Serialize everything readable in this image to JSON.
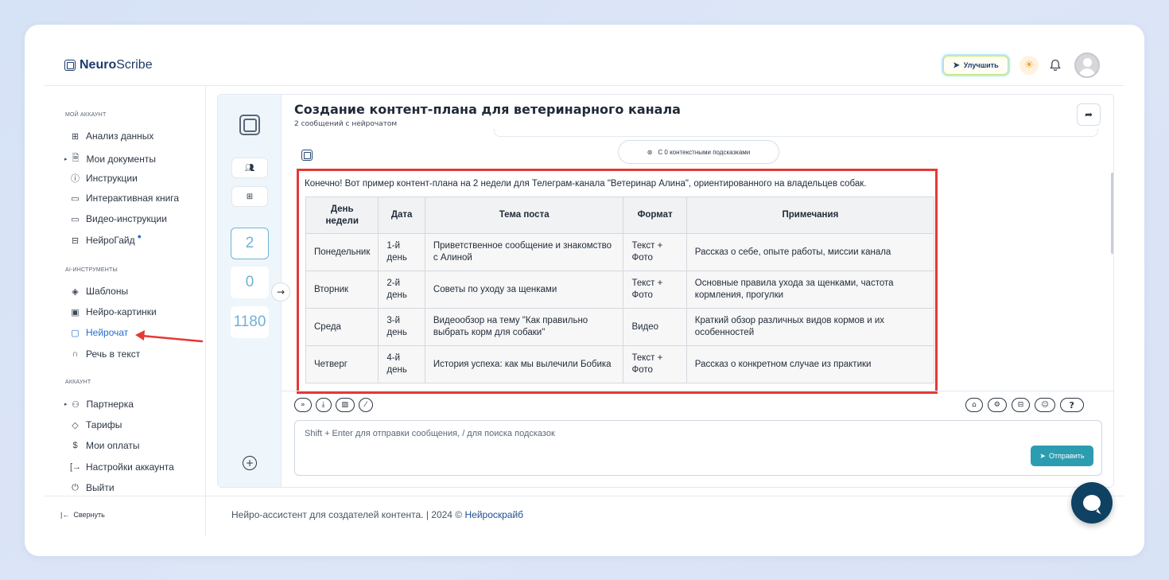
{
  "app": {
    "logo_bold": "Neuro",
    "logo_light": "Scribe",
    "upgrade_label": "Улучшить"
  },
  "sidebar": {
    "section_account": "МОЙ АККАУНТ",
    "section_tools": "AI-ИНСТРУМЕНТЫ",
    "section_acc2": "АККАУНТ",
    "items": [
      {
        "label": "Анализ данных",
        "icon": "grid-icon"
      },
      {
        "label": "Мои документы",
        "icon": "document-icon"
      },
      {
        "label": "Инструкции",
        "icon": "help-circle-icon"
      },
      {
        "label": "Интерактивная книга",
        "icon": "book-icon"
      },
      {
        "label": "Видео-инструкции",
        "icon": "video-icon"
      },
      {
        "label": "НейроГайд",
        "icon": "guide-icon"
      },
      {
        "label": "Шаблоны",
        "icon": "layers-icon"
      },
      {
        "label": "Нейро-картинки",
        "icon": "image-icon"
      },
      {
        "label": "Нейрочат",
        "icon": "chat-icon"
      },
      {
        "label": "Речь в текст",
        "icon": "headphones-icon"
      },
      {
        "label": "Партнерка",
        "icon": "users-icon"
      },
      {
        "label": "Тарифы",
        "icon": "tag-icon"
      },
      {
        "label": "Мои оплаты",
        "icon": "dollar-icon"
      },
      {
        "label": "Настройки аккаунта",
        "icon": "login-icon"
      },
      {
        "label": "Выйти",
        "icon": "power-icon"
      }
    ],
    "collapse_label": "Свернуть"
  },
  "rail": {
    "counts": [
      "2",
      "0",
      "1180"
    ]
  },
  "chat": {
    "title": "Создание контент-плана для ветеринарного канала",
    "subtitle": "2 сообщений с нейрочатом",
    "context_hints": "С 0 контекстными подсказками",
    "intro": "Конечно! Вот пример контент-плана на 2 недели для Телеграм-канала \"Ветеринар Алина\", ориентированного на владельцев собак.",
    "table": {
      "headers": [
        "День недели",
        "Дата",
        "Тема поста",
        "Формат",
        "Примечания"
      ],
      "rows": [
        [
          "Понедельник",
          "1-й день",
          "Приветственное сообщение и знакомство с Алиной",
          "Текст + Фото",
          "Рассказ о себе, опыте работы, миссии канала"
        ],
        [
          "Вторник",
          "2-й день",
          "Советы по уходу за щенками",
          "Текст + Фото",
          "Основные правила ухода за щенками, частота кормления, прогулки"
        ],
        [
          "Среда",
          "3-й день",
          "Видеообзор на тему \"Как правильно выбрать корм для собаки\"",
          "Видео",
          "Краткий обзор различных видов кормов и их особенностей"
        ],
        [
          "Четверг",
          "4-й день",
          "История успеха: как мы вылечили Бобика",
          "Текст + Фото",
          "Рассказ о конкретном случае из практики"
        ]
      ]
    },
    "input_placeholder": "Shift + Enter для отправки сообщения, / для поиска подсказок",
    "send_label": "Отправить",
    "help_label": "?"
  },
  "footer": {
    "text": "Нейро-ассистент для создателей контента.  | 2024 © ",
    "brand": "Нейроскрайб"
  },
  "colors": {
    "accent": "#1f6ed4",
    "send_button": "#2c9cb0",
    "highlight_border": "#e53935",
    "fab": "#0f4163"
  }
}
